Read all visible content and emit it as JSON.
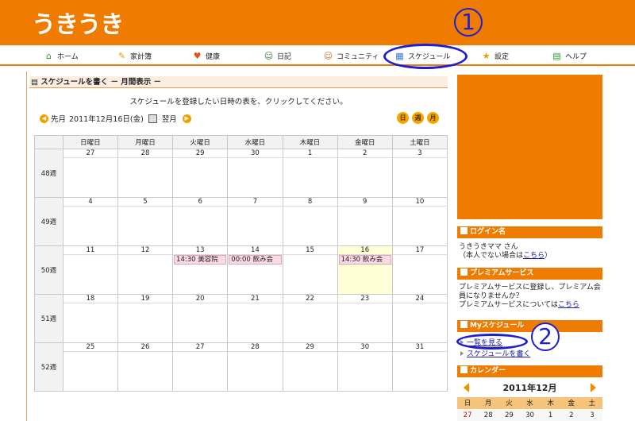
{
  "app": {
    "logo": "うきうき"
  },
  "annotations": {
    "one": "1",
    "two": "2"
  },
  "nav": [
    {
      "label": "ホーム",
      "icon": "home-icon",
      "glyph": "⌂",
      "color": "#3a8a2a"
    },
    {
      "label": "家計簿",
      "icon": "pencil-icon",
      "glyph": "✎",
      "color": "#d4a000"
    },
    {
      "label": "健康",
      "icon": "heart-icon",
      "glyph": "♥",
      "color": "#e05020"
    },
    {
      "label": "日記",
      "icon": "person-icon",
      "glyph": "☺",
      "color": "#2a7a2a"
    },
    {
      "label": "コミュニティ",
      "icon": "people-icon",
      "glyph": "☺",
      "color": "#c07020"
    },
    {
      "label": "スケジュール",
      "icon": "calendar-icon",
      "glyph": "▦",
      "color": "#3a7ad0"
    },
    {
      "label": "設定",
      "icon": "star-icon",
      "glyph": "★",
      "color": "#e8a000"
    },
    {
      "label": "ヘルプ",
      "icon": "help-icon",
      "glyph": "▤",
      "color": "#2a9a2a"
    }
  ],
  "page": {
    "section_title": "スケジュールを書く － 月間表示 －",
    "instruction": "スケジュールを登録したい日時の表を、クリックしてください。",
    "prev_label": "先月",
    "current_date": "2011年12月16日(金)",
    "next_label": "翌月",
    "view_buttons": [
      "日",
      "週",
      "月"
    ]
  },
  "calendar": {
    "headers": [
      "日曜日",
      "月曜日",
      "火曜日",
      "水曜日",
      "木曜日",
      "金曜日",
      "土曜日"
    ],
    "weeks": [
      {
        "label": "48週",
        "days": [
          "27",
          "28",
          "29",
          "30",
          "1",
          "2",
          "3"
        ]
      },
      {
        "label": "49週",
        "days": [
          "4",
          "5",
          "6",
          "7",
          "8",
          "9",
          "10"
        ]
      },
      {
        "label": "50週",
        "days": [
          "11",
          "12",
          "13",
          "14",
          "15",
          "16",
          "17"
        ]
      },
      {
        "label": "51週",
        "days": [
          "18",
          "19",
          "20",
          "21",
          "22",
          "23",
          "24"
        ]
      },
      {
        "label": "52週",
        "days": [
          "25",
          "26",
          "27",
          "28",
          "29",
          "30",
          "31"
        ]
      }
    ],
    "events": {
      "tue_13": "14:30 美容院",
      "wed_14": "00:00 飲み会",
      "fri_16": "14:30 飲み会"
    }
  },
  "sidebar": {
    "login": {
      "title": "ログイン名",
      "user": "うきうきママ さん",
      "not_you_prefix": "（本人でない場合は",
      "not_you_link": "こちら",
      "not_you_suffix": "）"
    },
    "premium": {
      "title": "プレミアムサービス",
      "text": "プレミアムサービスに登録し、プレミアム会員になりませんか？",
      "info_prefix": "プレミアムサービスについては",
      "info_link": "こちら"
    },
    "myschedule": {
      "title": "Myスケジュール",
      "link_list": "一覧を見る",
      "link_write": "スケジュールを書く"
    },
    "calendar": {
      "title": "カレンダー",
      "month": "2011年12月",
      "dow": [
        "日",
        "月",
        "火",
        "水",
        "木",
        "金",
        "土"
      ],
      "first_row": [
        "27",
        "28",
        "29",
        "30",
        "1",
        "2",
        "3"
      ]
    }
  },
  "colors": {
    "brand": "#ef7c00",
    "annotation": "#1f1fcf",
    "event": "#fdd8e6",
    "today": "#ffffd8"
  }
}
